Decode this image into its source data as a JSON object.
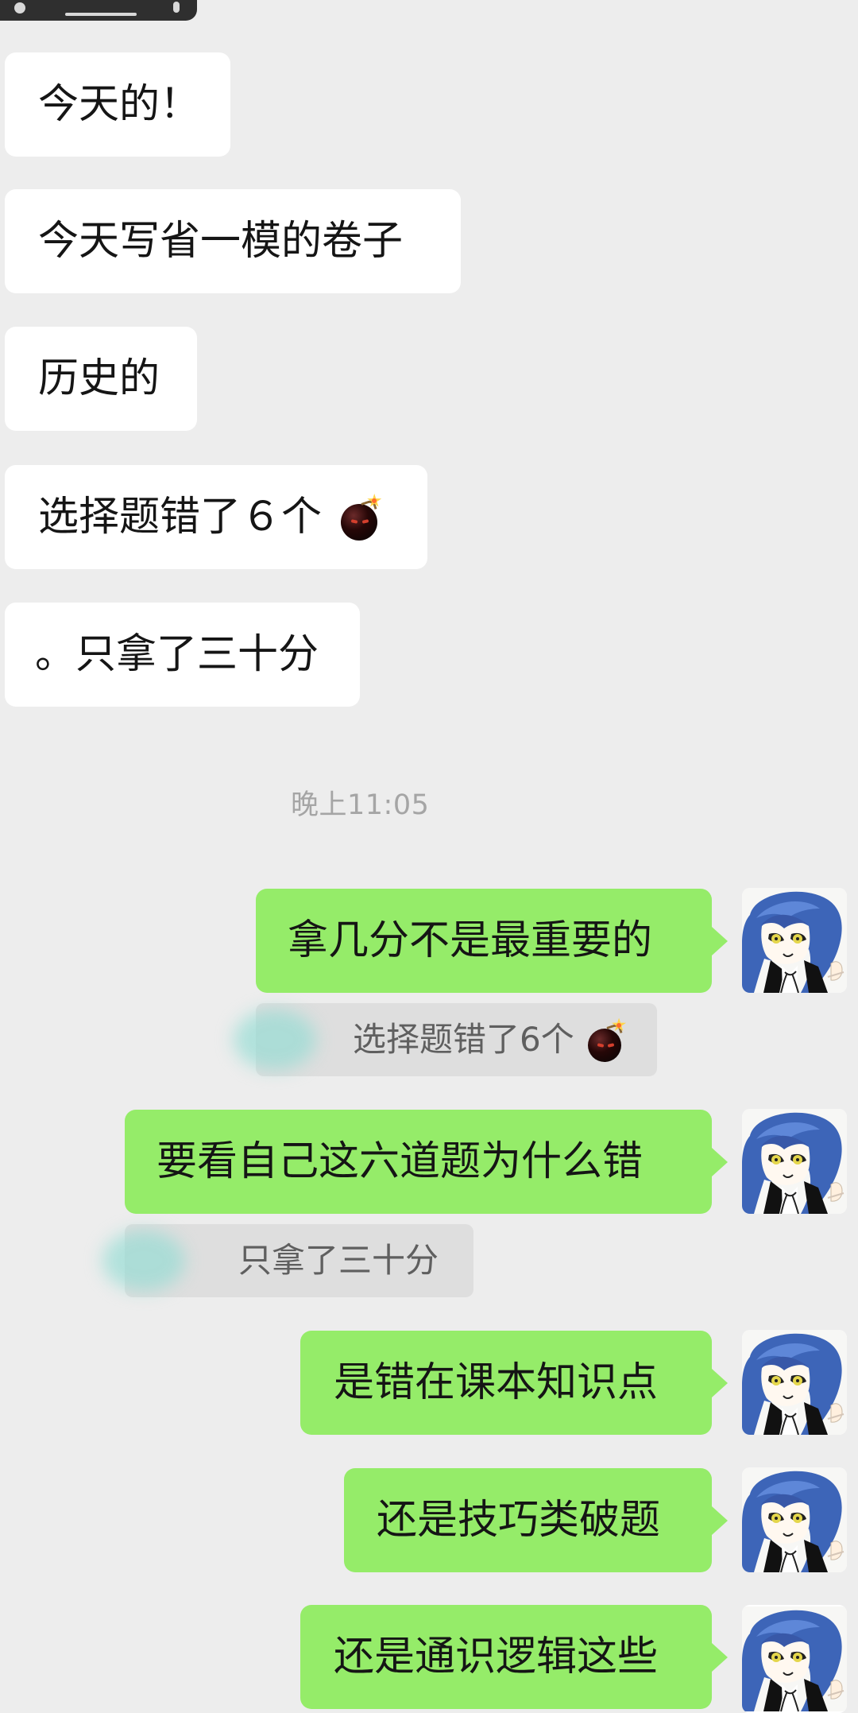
{
  "status_bar": {
    "icons": [
      "globe-icon",
      "home-indicator",
      "microphone-icon"
    ]
  },
  "colors": {
    "chat_background": "#ededed",
    "incoming_bubble": "#ffffff",
    "outgoing_bubble": "#95ec69",
    "quote_background": "#dedede",
    "time_text": "#a5a5a5"
  },
  "conversation": {
    "incoming_messages": [
      {
        "text": "今天的！"
      },
      {
        "text": "今天写省一模的卷子"
      },
      {
        "text": "历史的"
      },
      {
        "text": "选择题错了６个",
        "emoji": "bomb-icon"
      },
      {
        "text": "。只拿了三十分"
      }
    ],
    "timestamp": "晚上11:05",
    "outgoing_messages": [
      {
        "text": "拿几分不是最重要的",
        "quote": {
          "text": "选择题错了6个",
          "emoji": "bomb-icon"
        }
      },
      {
        "text": "要看自己这六道题为什么错",
        "quote": {
          "text": "只拿了三十分"
        }
      },
      {
        "text": "是错在课本知识点"
      },
      {
        "text": "还是技巧类破题"
      },
      {
        "text": "还是通识逻辑这些"
      }
    ]
  }
}
